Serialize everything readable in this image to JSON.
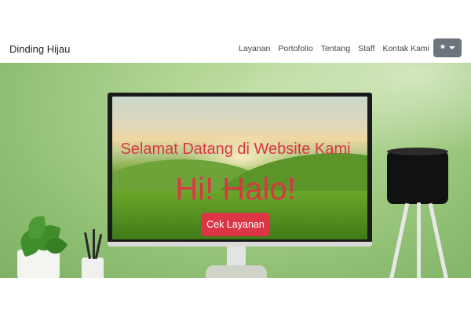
{
  "navbar": {
    "brand": "Dinding Hijau",
    "links": [
      "Layanan",
      "Portofolio",
      "Tentang",
      "Staff",
      "Kontak Kami"
    ],
    "theme_toggle_icon": "sun-icon"
  },
  "hero": {
    "welcome": "Selamat Datang di Website Kami",
    "greeting": "Hi! Halo!",
    "cta_label": "Cek Layanan"
  },
  "colors": {
    "accent": "#dc3545",
    "toggle": "#6c757d"
  }
}
